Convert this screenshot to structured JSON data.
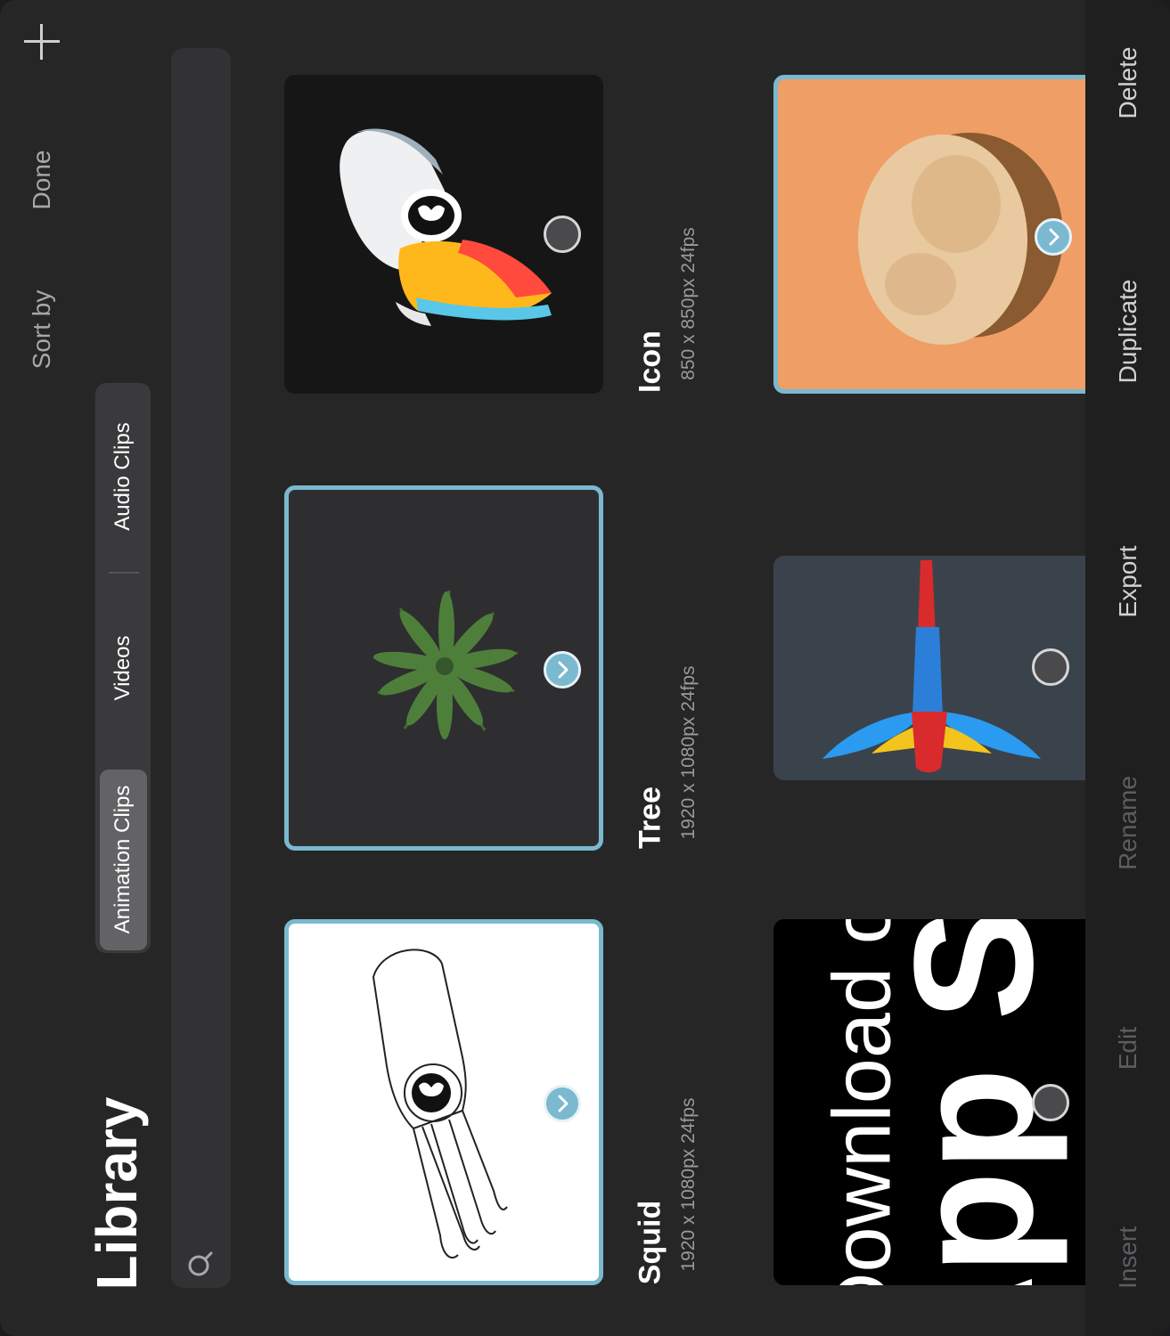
{
  "header": {
    "add_icon": "plus-icon",
    "done_label": "Done",
    "sort_label": "Sort by",
    "title": "Library"
  },
  "tabs": [
    {
      "label": "Animation Clips",
      "active": true
    },
    {
      "label": "Videos",
      "active": false
    },
    {
      "label": "Audio Clips",
      "active": false
    }
  ],
  "search": {
    "icon": "search-icon",
    "placeholder": ""
  },
  "clips": [
    {
      "name": "Icon",
      "meta": "850 x 850px 24fps",
      "selected": false
    },
    {
      "name": "Tree",
      "meta": "1920 x 1080px 24fps",
      "selected": true
    },
    {
      "name": "Squid",
      "meta": "1920 x 1080px 24fps",
      "selected": true
    }
  ],
  "second_row": [
    {
      "selected": true
    },
    {
      "selected": false
    },
    {
      "banner_line1": "Download o",
      "banner_line2": "App St",
      "selected": false
    }
  ],
  "toolbar": {
    "delete": "Delete",
    "duplicate": "Duplicate",
    "export": "Export",
    "rename": "Rename",
    "edit": "Edit",
    "insert": "Insert"
  },
  "colors": {
    "accent": "#7ab9cf",
    "background": "#262627",
    "orange": "#ef9e66"
  }
}
